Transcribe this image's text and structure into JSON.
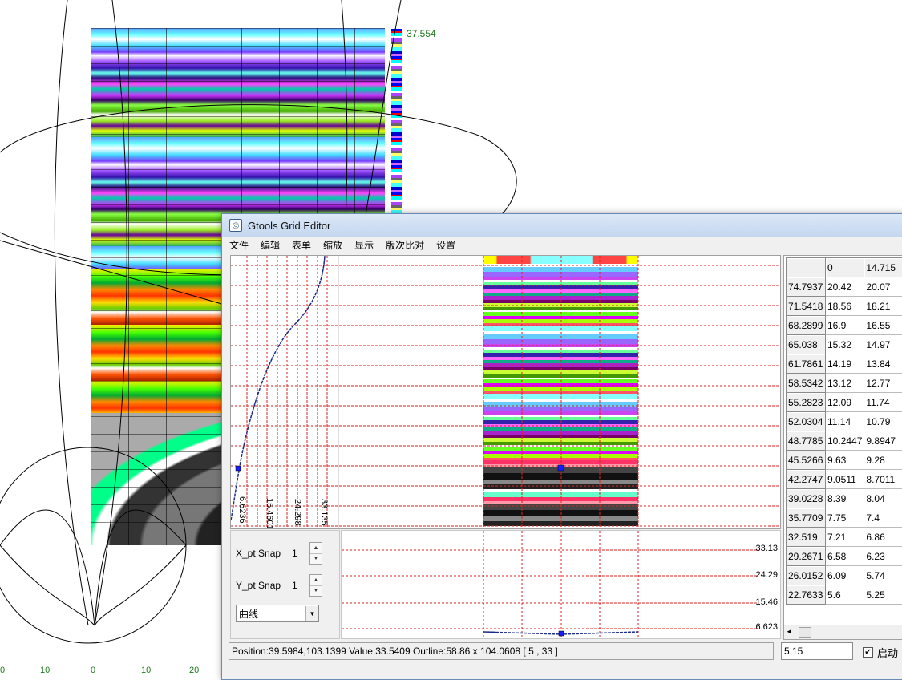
{
  "background": {
    "legend_max": "37.554",
    "bottom_axis_ticks": [
      "0",
      "10",
      "0",
      "10",
      "20"
    ]
  },
  "window": {
    "title": "Gtools Grid Editor",
    "app_icon": "grid-editor-app-icon"
  },
  "menu": {
    "items": [
      "文件",
      "编辑",
      "表单",
      "缩放",
      "显示",
      "版次比对",
      "设置"
    ]
  },
  "plot": {
    "axis_labels": [
      "6.6236",
      "15.4601",
      "24.298",
      "33.135"
    ]
  },
  "snap": {
    "x_label": "X_pt Snap",
    "x_value": "1",
    "y_label": "Y_pt Snap",
    "y_value": "1",
    "mode_selected": "曲线"
  },
  "profile": {
    "labels": [
      "33.13",
      "24.29",
      "15.46",
      "6.623"
    ]
  },
  "table": {
    "header": [
      "",
      "0",
      "14.715"
    ],
    "rows": [
      [
        "74.7937",
        "20.42",
        "20.07"
      ],
      [
        "71.5418",
        "18.56",
        "18.21"
      ],
      [
        "68.2899",
        "16.9",
        "16.55"
      ],
      [
        "65.038",
        "15.32",
        "14.97"
      ],
      [
        "61.7861",
        "14.19",
        "13.84"
      ],
      [
        "58.5342",
        "13.12",
        "12.77"
      ],
      [
        "55.2823",
        "12.09",
        "11.74"
      ],
      [
        "52.0304",
        "11.14",
        "10.79"
      ],
      [
        "48.7785",
        "10.2447",
        "9.8947"
      ],
      [
        "45.5266",
        "9.63",
        "9.28"
      ],
      [
        "42.2747",
        "9.0511",
        "8.7011"
      ],
      [
        "39.0228",
        "8.39",
        "8.04"
      ],
      [
        "35.7709",
        "7.75",
        "7.4"
      ],
      [
        "32.519",
        "7.21",
        "6.86"
      ],
      [
        "29.2671",
        "6.58",
        "6.23"
      ],
      [
        "26.0152",
        "6.09",
        "5.74"
      ],
      [
        "22.7633",
        "5.6",
        "5.25"
      ]
    ]
  },
  "status": {
    "text": "Position:39.5984,103.1399 Value:33.5409 Outline:58.86 x 104.0608 [ 5 , 33 ]",
    "value_input": "5.15",
    "enable_label": "启动",
    "enable_checked": true
  }
}
